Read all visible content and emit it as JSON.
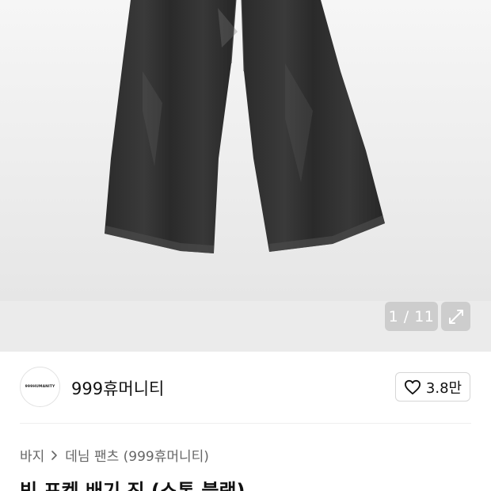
{
  "gallery": {
    "counter": "1 / 11",
    "image_alt": "jeans-product-photo",
    "expand_icon": "expand-icon"
  },
  "brand": {
    "logo_text": "999HUMANITY",
    "name": "999휴머니티",
    "like_icon": "heart-icon",
    "like_count": "3.8만"
  },
  "breadcrumb": {
    "items": [
      "바지",
      "데님 팬츠 (999휴머니티)"
    ],
    "separator_icon": "chevron-right-icon"
  },
  "product": {
    "title": "빅 포켓 배기 진 (스톤 블랙)"
  },
  "colors": {
    "overlay_button": "#cdcdcd",
    "gallery_bg": "#e9e9e9",
    "text_primary": "#111111",
    "text_secondary": "#666666"
  }
}
